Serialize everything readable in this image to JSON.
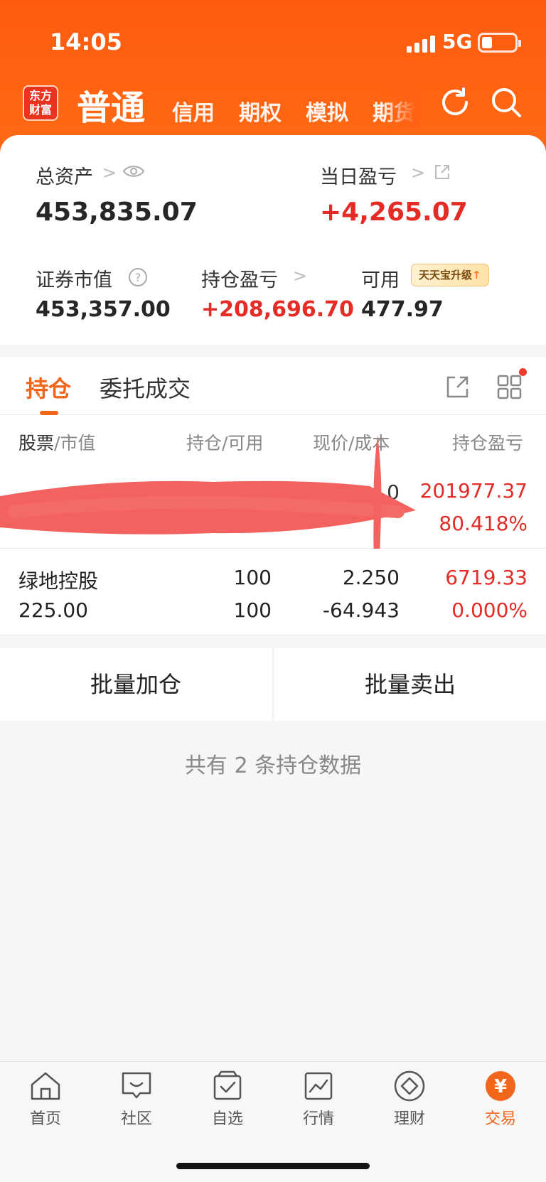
{
  "status_bar": {
    "time": "14:05",
    "network": "5G"
  },
  "header": {
    "logo_text_line1": "东方",
    "logo_text_line2": "财富",
    "active_tab": "普通",
    "tabs": [
      "信用",
      "期权",
      "模拟",
      "期货"
    ]
  },
  "summary": {
    "total_assets_label": "总资产",
    "total_assets_value": "453,835.07",
    "daily_pnl_label": "当日盈亏",
    "daily_pnl_value": "+4,265.07",
    "market_value_label": "证券市值",
    "market_value_value": "453,357.00",
    "position_pnl_label": "持仓盈亏",
    "position_pnl_value": "+208,696.70",
    "available_label": "可用",
    "available_value": "477.97",
    "upgrade_badge": "天天宝升级",
    "help_icon_text": "?"
  },
  "positions_tabs": {
    "active": "持仓",
    "other": "委托成交"
  },
  "table": {
    "headers": {
      "col1_main": "股票",
      "col1_sub": "/市值",
      "col2": "持仓/可用",
      "col3": "现价/成本",
      "col4": "持仓盈亏"
    },
    "rows": [
      {
        "name": "",
        "market_value": "",
        "holding": "",
        "available": "",
        "price": "0",
        "cost": "",
        "pnl": "201977.37",
        "pnl_pct": "80.418%"
      },
      {
        "name": "绿地控股",
        "market_value": "225.00",
        "holding": "100",
        "available": "100",
        "price": "2.250",
        "cost": "-64.943",
        "pnl": "6719.33",
        "pnl_pct": "0.000%"
      }
    ]
  },
  "actions": {
    "batch_add": "批量加仓",
    "batch_sell": "批量卖出"
  },
  "footer_note": "共有 2 条持仓数据",
  "bottom_nav": [
    {
      "label": "首页",
      "icon": "home-icon"
    },
    {
      "label": "社区",
      "icon": "community-icon"
    },
    {
      "label": "自选",
      "icon": "watchlist-icon"
    },
    {
      "label": "行情",
      "icon": "market-icon"
    },
    {
      "label": "理财",
      "icon": "wealth-icon"
    },
    {
      "label": "交易",
      "icon": "trade-icon",
      "active_icon_text": "¥"
    }
  ],
  "colors": {
    "brand_orange": "#ff5a10",
    "profit_red": "#e52b26",
    "accent": "#f2661b"
  }
}
